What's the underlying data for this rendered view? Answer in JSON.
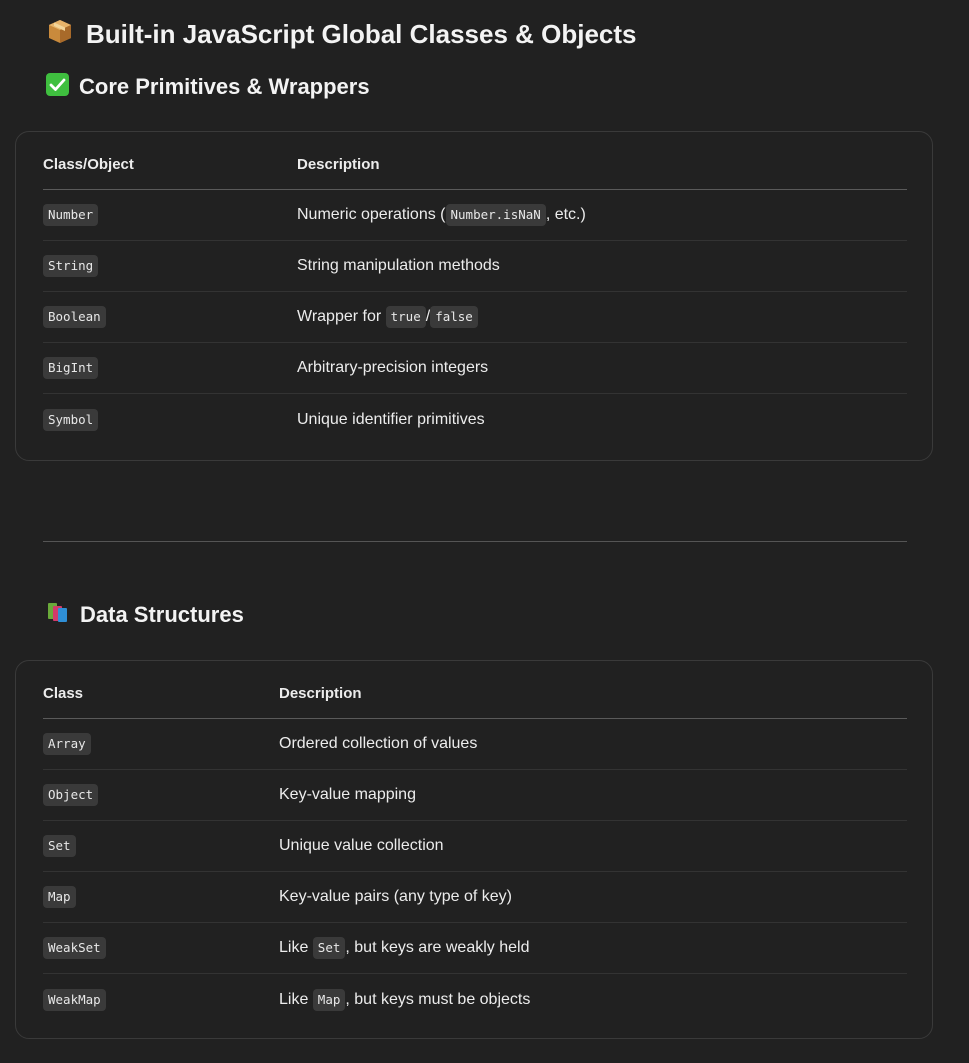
{
  "title": "Built-in JavaScript Global Classes & Objects",
  "title_icon": "package-icon",
  "section1": {
    "heading": "Core Primitives & Wrappers",
    "heading_icon": "check-mark-icon",
    "col1": "Class/Object",
    "col2": "Description",
    "rows": [
      {
        "name": "Number",
        "desc_pre": "Numeric operations (",
        "desc_code": "Number.isNaN",
        "desc_post": ", etc.)"
      },
      {
        "name": "String",
        "desc": "String manipulation methods"
      },
      {
        "name": "Boolean",
        "desc_pre": "Wrapper for ",
        "desc_code1": "true",
        "desc_sep": "/",
        "desc_code2": "false"
      },
      {
        "name": "BigInt",
        "desc": "Arbitrary-precision integers"
      },
      {
        "name": "Symbol",
        "desc": "Unique identifier primitives"
      }
    ]
  },
  "section2": {
    "heading": "Data Structures",
    "heading_icon": "books-icon",
    "col1": "Class",
    "col2": "Description",
    "rows": [
      {
        "name": "Array",
        "desc": "Ordered collection of values"
      },
      {
        "name": "Object",
        "desc": "Key-value mapping"
      },
      {
        "name": "Set",
        "desc": "Unique value collection"
      },
      {
        "name": "Map",
        "desc": "Key-value pairs (any type of key)"
      },
      {
        "name": "WeakSet",
        "desc_pre": "Like ",
        "desc_code": "Set",
        "desc_post": ", but keys are weakly held"
      },
      {
        "name": "WeakMap",
        "desc_pre": "Like ",
        "desc_code": "Map",
        "desc_post": ", but keys must be objects"
      }
    ]
  },
  "colors": {
    "background": "#212121",
    "text": "#ececec",
    "code_bg": "#3a3a3a",
    "check_green": "#3fbf3f"
  }
}
